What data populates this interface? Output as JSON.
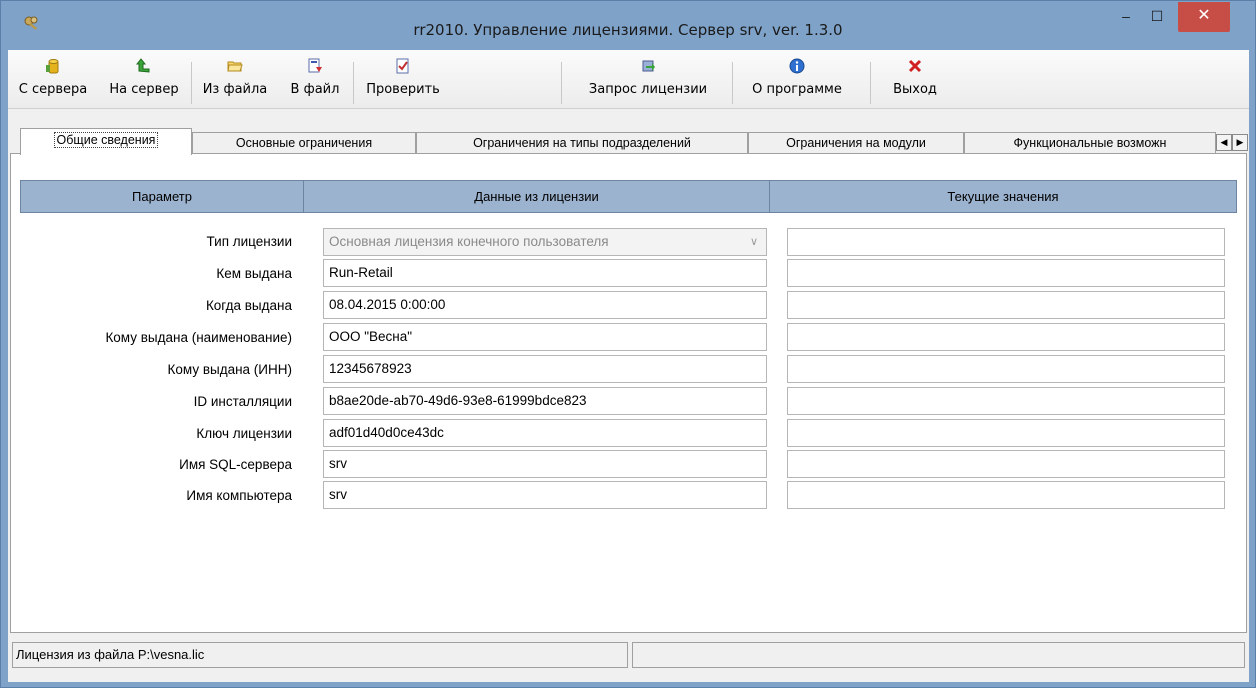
{
  "window": {
    "title": "rr2010. Управление лицензиями. Сервер srv, ver. 1.3.0",
    "min_glyph": "–",
    "max_glyph": "☐",
    "close_glyph": "✕"
  },
  "toolbar": {
    "items": [
      {
        "label": "С сервера",
        "icon": "db-download-icon"
      },
      {
        "label": "На сервер",
        "icon": "arrow-up-icon"
      },
      {
        "label": "Из файла",
        "icon": "folder-open-icon"
      },
      {
        "label": "В файл",
        "icon": "save-file-icon"
      },
      {
        "label": "Проверить",
        "icon": "check-document-icon"
      },
      {
        "label": "Запрос лицензии",
        "icon": "license-request-icon"
      },
      {
        "label": "О программе",
        "icon": "info-icon"
      },
      {
        "label": "Выход",
        "icon": "exit-x-icon"
      }
    ]
  },
  "tabs": [
    "Общие сведения",
    "Основные ограничения",
    "Ограничения на типы подразделений",
    "Ограничения на модули",
    "Функциональные возможн"
  ],
  "tab_scroll": {
    "left": "◀",
    "right": "▶"
  },
  "grid": {
    "headers": [
      "Параметр",
      "Данные из лицензии",
      "Текущие значения"
    ],
    "rows": [
      {
        "label": "Тип лицензии",
        "value": "Основная лицензия конечного пользователя",
        "current": "",
        "combo": true
      },
      {
        "label": "Кем выдана",
        "value": "Run-Retail",
        "current": ""
      },
      {
        "label": "Когда выдана",
        "value": "08.04.2015 0:00:00",
        "current": ""
      },
      {
        "label": "Кому выдана (наименование)",
        "value": "ООО \"Весна\"",
        "current": ""
      },
      {
        "label": "Кому выдана (ИНН)",
        "value": "12345678923",
        "current": ""
      },
      {
        "label": "ID инсталляции",
        "value": "b8ae20de-ab70-49d6-93e8-61999bdce823",
        "current": ""
      },
      {
        "label": "Ключ лицензии",
        "value": "adf01d40d0ce43dc",
        "current": ""
      },
      {
        "label": "Имя SQL-сервера",
        "value": "srv",
        "current": ""
      },
      {
        "label": "Имя компьютера",
        "value": "srv",
        "current": ""
      }
    ],
    "combo_arrow": "∨"
  },
  "status": {
    "left": "Лицензия из файла P:\\vesna.lic",
    "right": ""
  },
  "colors": {
    "title_bar": "#7fa2c9",
    "grid_header": "#9cb3cf",
    "close_button": "#c74d47"
  }
}
